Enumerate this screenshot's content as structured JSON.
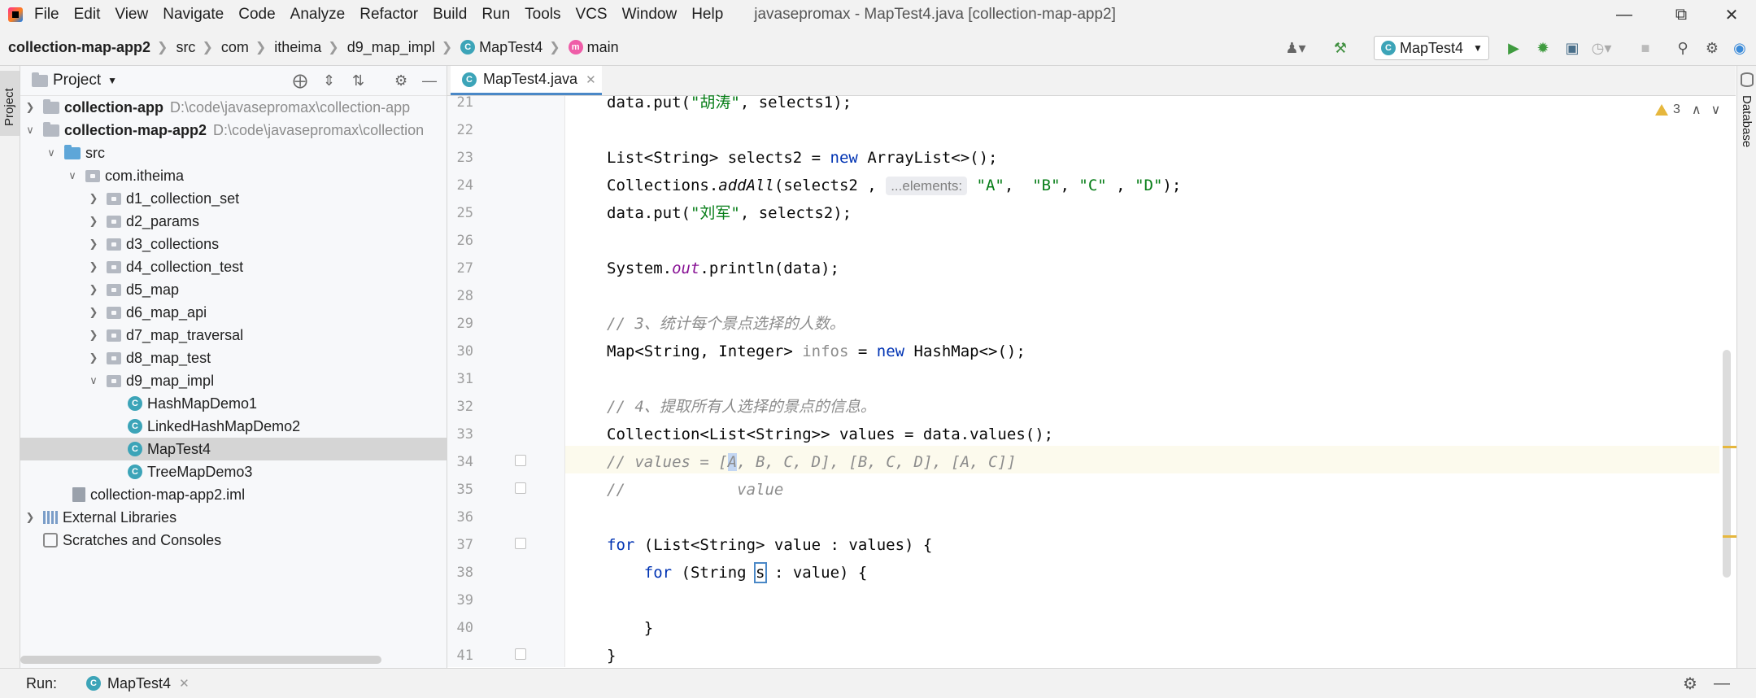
{
  "menubar": {
    "items": [
      "File",
      "Edit",
      "View",
      "Navigate",
      "Code",
      "Analyze",
      "Refactor",
      "Build",
      "Run",
      "Tools",
      "VCS",
      "Window",
      "Help"
    ],
    "title": "javasepromax - MapTest4.java [collection-map-app2]"
  },
  "navbar": {
    "crumbs": [
      "collection-map-app2",
      "src",
      "com",
      "itheima",
      "d9_map_impl",
      "MapTest4",
      "main"
    ],
    "run_config": "MapTest4"
  },
  "left_stripe": {
    "project_tab": "Project"
  },
  "project": {
    "header": "Project",
    "tree": [
      {
        "label": "collection-app",
        "path": "D:\\code\\javasepromax\\collection-app"
      },
      {
        "label": "collection-map-app2",
        "path": "D:\\code\\javasepromax\\collection"
      },
      {
        "label": "src"
      },
      {
        "label": "com.itheima"
      },
      {
        "label": "d1_collection_set"
      },
      {
        "label": "d2_params"
      },
      {
        "label": "d3_collections"
      },
      {
        "label": "d4_collection_test"
      },
      {
        "label": "d5_map"
      },
      {
        "label": "d6_map_api"
      },
      {
        "label": "d7_map_traversal"
      },
      {
        "label": "d8_map_test"
      },
      {
        "label": "d9_map_impl"
      },
      {
        "label": "HashMapDemo1"
      },
      {
        "label": "LinkedHashMapDemo2"
      },
      {
        "label": "MapTest4"
      },
      {
        "label": "TreeMapDemo3"
      },
      {
        "label": "collection-map-app2.iml"
      },
      {
        "label": "External Libraries"
      },
      {
        "label": "Scratches and Consoles"
      }
    ]
  },
  "editor": {
    "tab": "MapTest4.java",
    "warnings": "3",
    "line_numbers": [
      "21",
      "22",
      "23",
      "24",
      "25",
      "26",
      "27",
      "28",
      "29",
      "30",
      "31",
      "32",
      "33",
      "34",
      "35",
      "36",
      "37",
      "38",
      "39",
      "40",
      "41"
    ],
    "code": {
      "l21": {
        "a": "data.put(",
        "s": "\"胡涛\"",
        "b": ", selects1);"
      },
      "l23": {
        "a": "List<String> selects2 = ",
        "kw": "new",
        "b": " ArrayList<>();"
      },
      "l24": {
        "a": "Collections.",
        "m": "addAll",
        "b": "(selects2 , ",
        "hint": "...elements:",
        "c": "\"A\"",
        "d": ",  ",
        "e": "\"B\"",
        "f": ", ",
        "g": "\"C\"",
        "h": " , ",
        "i": "\"D\"",
        "j": ");"
      },
      "l25": {
        "a": "data.put(",
        "s": "\"刘军\"",
        "b": ", selects2);"
      },
      "l27": {
        "a": "System.",
        "f": "out",
        "b": ".println(data);"
      },
      "l29": {
        "c": "// 3、统计每个景点选择的人数。"
      },
      "l30": {
        "a": "Map<String, Integer> ",
        "v": "infos",
        "b": " = ",
        "kw": "new",
        "c": " HashMap<>();"
      },
      "l32": {
        "c": "// 4、提取所有人选择的景点的信息。"
      },
      "l33": {
        "a": "Collection<List<String>> values = data.values();"
      },
      "l34": {
        "a": "// values = [",
        "sel": "A",
        "b": ", B, C, D], [B, C, D], [A, C]]"
      },
      "l35": {
        "c": "//            value"
      },
      "l37": {
        "kw": "for",
        "a": " (List<String> value : values) {"
      },
      "l38": {
        "kw": "for",
        "a": " (String ",
        "s": "s",
        "b": " : value) {"
      },
      "l40": {
        "a": "}"
      },
      "l41": {
        "a": "}"
      }
    }
  },
  "right_stripe": {
    "database_tab": "Database"
  },
  "runbar": {
    "label": "Run:",
    "tab": "MapTest4"
  }
}
